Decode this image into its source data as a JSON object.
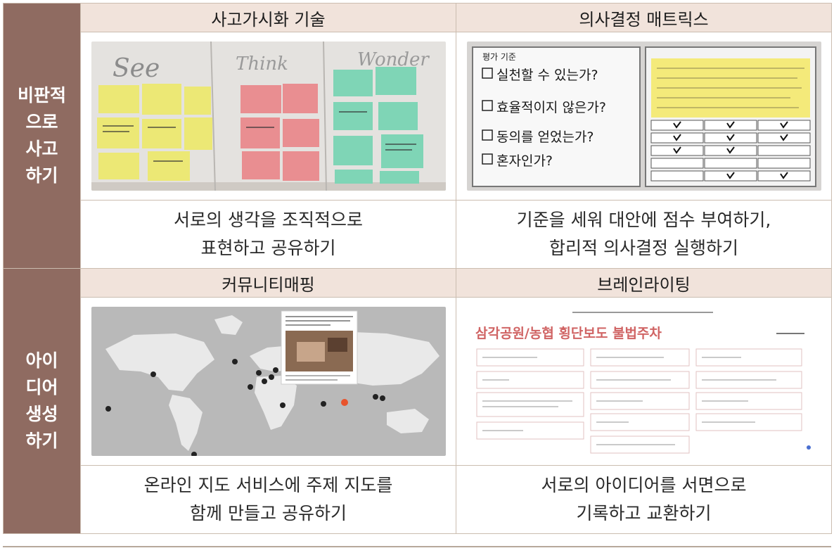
{
  "sections": [
    {
      "category_lines": [
        "비판적",
        "으로",
        "사고",
        "하기"
      ],
      "cells": [
        {
          "title": "사고가시화 기술",
          "image": {
            "type": "sticky-notes-board",
            "headings": [
              "See",
              "Think",
              "Wonder"
            ]
          },
          "desc_lines": [
            "서로의 생각을 조직적으로",
            "표현하고 공유하기"
          ]
        },
        {
          "title": "의사결정 매트릭스",
          "image": {
            "type": "decision-matrix-whiteboard",
            "criteria": [
              "실천할 수 있는가?",
              "효율적이지 않은가?",
              "동의를 얻었는가?",
              "혼자인가?"
            ]
          },
          "desc_lines": [
            "기준을 세워 대안에 점수 부여하기,",
            "합리적 의사결정 실행하기"
          ]
        }
      ]
    },
    {
      "category_lines": [
        "아이",
        "디어",
        "생성",
        "하기"
      ],
      "cells": [
        {
          "title": "커뮤니티매핑",
          "image": {
            "type": "world-map-pins"
          },
          "desc_lines": [
            "온라인 지도 서비스에 주제 지도를",
            "함께 만들고 공유하기"
          ]
        },
        {
          "title": "브레인라이팅",
          "image": {
            "type": "brainwriting-board",
            "heading": "삼각공원/농협 횡단보도 불법주차"
          },
          "desc_lines": [
            "서로의 아이디어를 서면으로",
            "기록하고 교환하기"
          ]
        }
      ]
    }
  ]
}
